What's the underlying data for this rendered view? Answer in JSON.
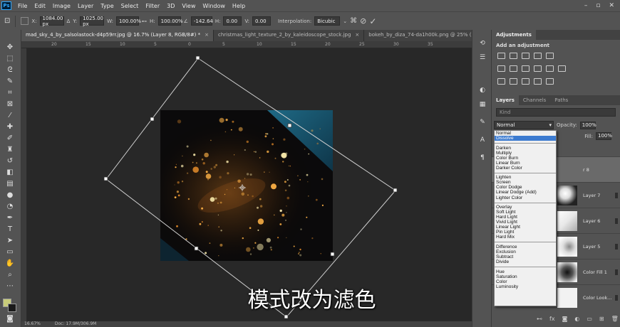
{
  "menubar": {
    "logo": "Ps",
    "items": [
      "File",
      "Edit",
      "Image",
      "Layer",
      "Type",
      "Select",
      "Filter",
      "3D",
      "View",
      "Window",
      "Help"
    ]
  },
  "options": {
    "x_label": "X:",
    "x_value": "1084.00 px",
    "y_label": "Y:",
    "y_value": "1025.00 px",
    "w_label": "W:",
    "w_value": "100.00%",
    "h_label": "H:",
    "h_value": "100.00%",
    "angle_value": "-142.64",
    "hskew_label": "H:",
    "hskew_value": "0.00",
    "vskew_label": "V:",
    "vskew_value": "0.00",
    "interp_label": "Interpolation:",
    "interp_value": "Bicubic"
  },
  "tabs": [
    {
      "label": "mad_sky_4_by_salsolastock-d4p59rr.jpg @ 16.7% (Layer 8, RGB/8#) *",
      "active": true
    },
    {
      "label": "christmas_light_texture_2_by_kaleidoscope_stock.jpg",
      "active": false
    },
    {
      "label": "bokeh_by_diza_74-da1h00k.png @ 25% (Laye",
      "active": false
    }
  ],
  "ruler_ticks": [
    "20",
    "15",
    "10",
    "5",
    "0",
    "5",
    "10",
    "15",
    "20",
    "25",
    "30",
    "35"
  ],
  "status": {
    "zoom": "16.67%",
    "doc": "Doc: 17.9M/306.9M"
  },
  "panel": {
    "adjust_tab": "Adjustments",
    "adjust_title": "Add an adjustment",
    "layer_tabs": [
      "Layers",
      "Channels",
      "Paths"
    ],
    "search_placeholder": "Kind",
    "blend_value": "Normal",
    "opacity_label": "Opacity:",
    "opacity_value": "100%",
    "fill_label": "Fill:",
    "fill_value": "100%",
    "layers": [
      "r 8",
      "Layer 7",
      "Layer 6",
      "Layer 5",
      "Color Fill 1",
      "Color Look..."
    ]
  },
  "blend_modes": [
    [
      "Normal",
      "Dissolve"
    ],
    [
      "Darken",
      "Multiply",
      "Color Burn",
      "Linear Burn",
      "Darker Color"
    ],
    [
      "Lighten",
      "Screen",
      "Color Dodge",
      "Linear Dodge (Add)",
      "Lighter Color"
    ],
    [
      "Overlay",
      "Soft Light",
      "Hard Light",
      "Vivid Light",
      "Linear Light",
      "Pin Light",
      "Hard Mix"
    ],
    [
      "Difference",
      "Exclusion",
      "Subtract",
      "Divide"
    ],
    [
      "Hue",
      "Saturation",
      "Color",
      "Luminosity"
    ]
  ],
  "selected_mode": "Dissolve",
  "caption": "模式改为滤色",
  "colors": {
    "foreground": "#c8cc7a",
    "background": "#1a1a1a",
    "accent": "#3c7bd0"
  }
}
